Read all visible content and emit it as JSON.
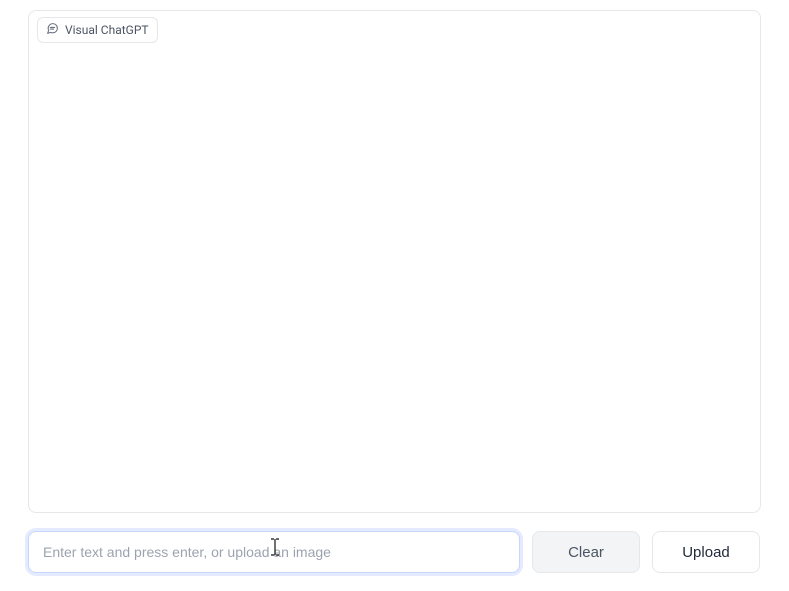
{
  "chat": {
    "title": "Visual ChatGPT"
  },
  "input": {
    "placeholder": "Enter text and press enter, or upload an image",
    "value": ""
  },
  "buttons": {
    "clear": "Clear",
    "upload": "Upload"
  }
}
